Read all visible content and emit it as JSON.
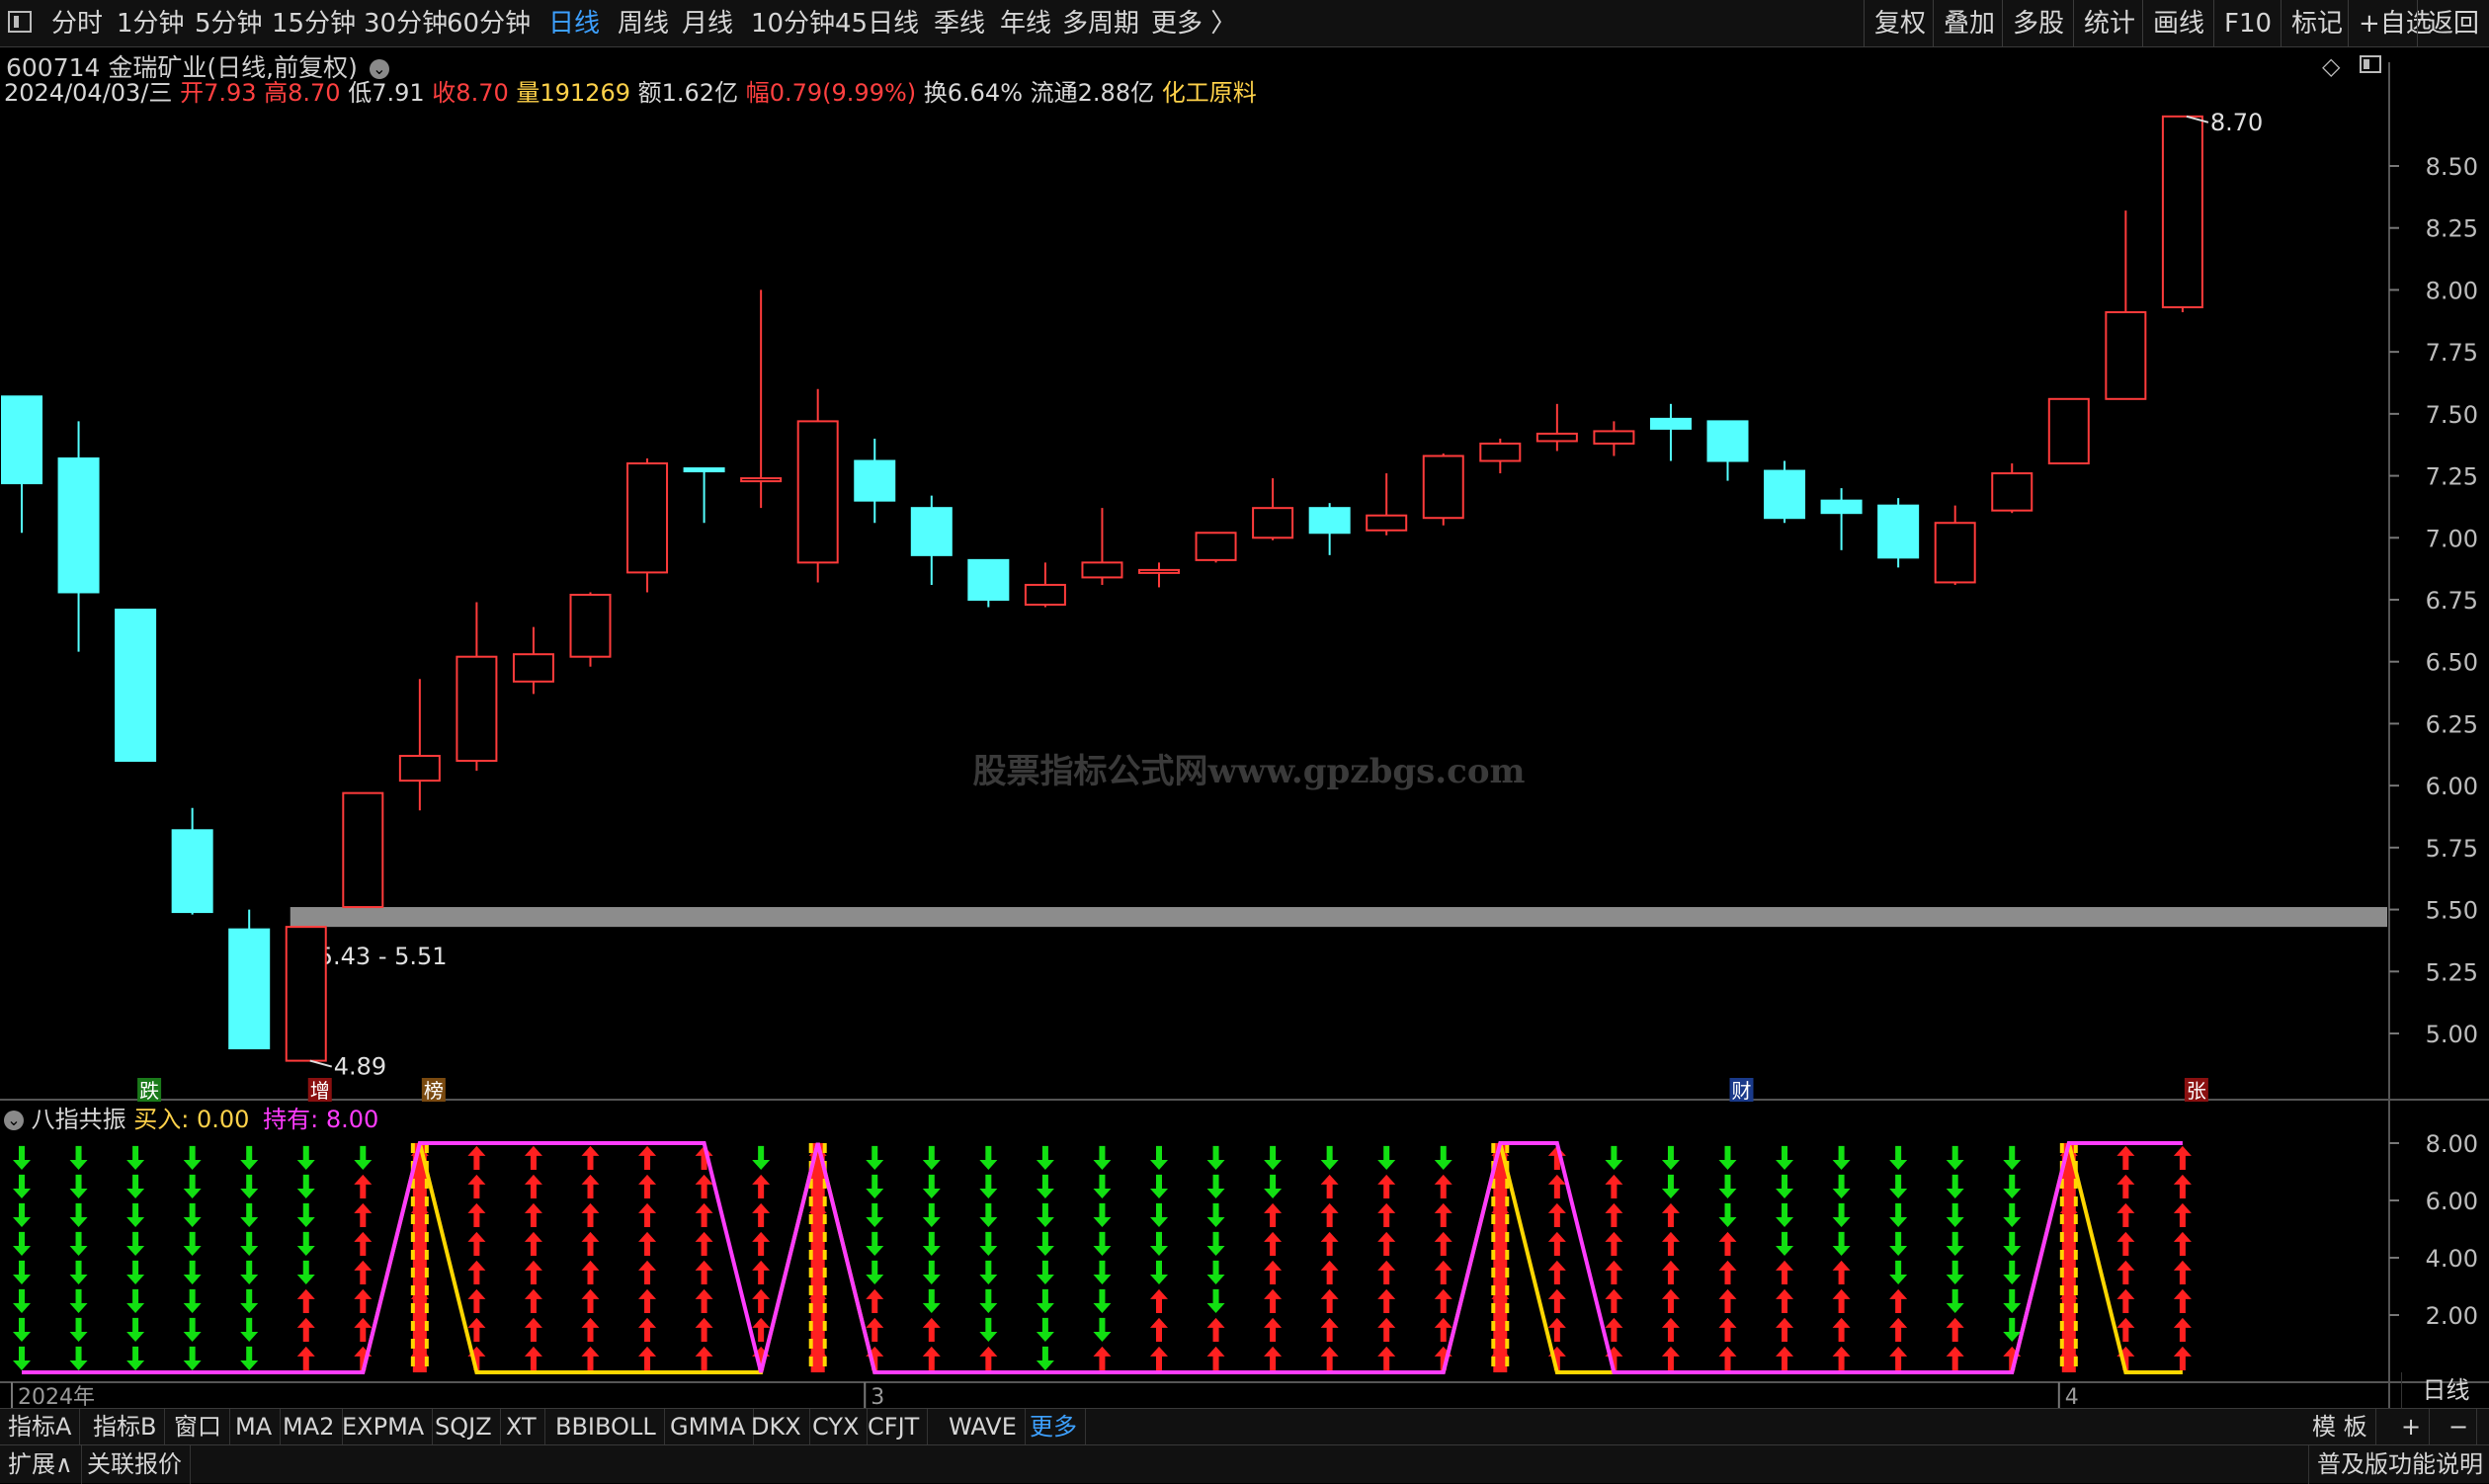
{
  "topbar": {
    "menu_icon": "panel-toggle-icon",
    "periods": [
      {
        "label": "分时",
        "active": false
      },
      {
        "label": "1分钟",
        "active": false
      },
      {
        "label": "5分钟",
        "active": false
      },
      {
        "label": "15分钟",
        "active": false
      },
      {
        "label": "30分钟",
        "active": false
      },
      {
        "label": "60分钟",
        "active": false
      },
      {
        "label": "日线",
        "active": true
      },
      {
        "label": "周线",
        "active": false
      },
      {
        "label": "月线",
        "active": false
      },
      {
        "label": "10分钟",
        "active": false
      },
      {
        "label": "45日线",
        "active": false
      },
      {
        "label": "季线",
        "active": false
      },
      {
        "label": "年线",
        "active": false
      },
      {
        "label": "多周期",
        "active": false
      },
      {
        "label": "更多 〉",
        "active": false
      }
    ],
    "right_buttons": [
      "复权",
      "叠加",
      "多股",
      "统计",
      "画线",
      "F10",
      "标记",
      "+自选",
      "返回"
    ]
  },
  "header": {
    "code_name": "600714 金瑞矿业(日线,前复权)",
    "date": "2024/04/03/三",
    "open_label": "开",
    "open": "7.93",
    "high_label": "高",
    "high": "8.70",
    "low_label": "低",
    "low": "7.91",
    "close_label": "收",
    "close": "8.70",
    "vol_label": "量",
    "vol": "191269",
    "amt_label": "额",
    "amt": "1.62亿",
    "chg_label": "幅",
    "chg": "0.79(9.99%)",
    "turn_label": "换",
    "turn": "6.64%",
    "float_label": "流通",
    "float": "2.88亿",
    "sector": "化工原料"
  },
  "watermark": "股票指标公式网www.gpzbgs.com",
  "indicator": {
    "name": "八指共振",
    "buy_label": "买入:",
    "buy_value": "0.00",
    "hold_label": "持有:",
    "hold_value": "8.00"
  },
  "chart_data": [
    {
      "type": "candlestick",
      "title": "600714 金瑞矿业(日线,前复权)",
      "ylim": [
        4.88,
        8.75
      ],
      "y_ticks": [
        "8.50",
        "8.25",
        "8.00",
        "7.75",
        "7.50",
        "7.25",
        "7.00",
        "6.75",
        "6.50",
        "6.25",
        "6.00",
        "5.75",
        "5.50",
        "5.25",
        "5.00"
      ],
      "x_ticks": [
        {
          "index": 0,
          "label": "2024年"
        },
        {
          "index": 15,
          "label": "3"
        },
        {
          "index": 36,
          "label": "4"
        }
      ],
      "candles": [
        {
          "o": 7.57,
          "h": 7.57,
          "l": 7.02,
          "c": 7.22
        },
        {
          "o": 7.32,
          "h": 7.47,
          "l": 6.54,
          "c": 6.78
        },
        {
          "o": 6.71,
          "h": 6.71,
          "l": 6.1,
          "c": 6.1
        },
        {
          "o": 5.82,
          "h": 5.91,
          "l": 5.48,
          "c": 5.49
        },
        {
          "o": 5.42,
          "h": 5.5,
          "l": 4.94,
          "c": 4.94
        },
        {
          "o": 4.89,
          "h": 5.43,
          "l": 4.89,
          "c": 5.43
        },
        {
          "o": 5.51,
          "h": 5.97,
          "l": 5.51,
          "c": 5.97
        },
        {
          "o": 6.02,
          "h": 6.43,
          "l": 5.9,
          "c": 6.12
        },
        {
          "o": 6.1,
          "h": 6.74,
          "l": 6.06,
          "c": 6.52
        },
        {
          "o": 6.42,
          "h": 6.64,
          "l": 6.37,
          "c": 6.53
        },
        {
          "o": 6.52,
          "h": 6.78,
          "l": 6.48,
          "c": 6.77
        },
        {
          "o": 6.86,
          "h": 7.32,
          "l": 6.78,
          "c": 7.3
        },
        {
          "o": 7.28,
          "h": 7.28,
          "l": 7.06,
          "c": 7.27
        },
        {
          "o": 7.24,
          "h": 8.0,
          "l": 7.12,
          "c": 7.24
        },
        {
          "o": 6.9,
          "h": 7.6,
          "l": 6.82,
          "c": 7.47
        },
        {
          "o": 7.31,
          "h": 7.4,
          "l": 7.06,
          "c": 7.15
        },
        {
          "o": 7.12,
          "h": 7.17,
          "l": 6.81,
          "c": 6.93
        },
        {
          "o": 6.91,
          "h": 6.91,
          "l": 6.72,
          "c": 6.75
        },
        {
          "o": 6.73,
          "h": 6.9,
          "l": 6.72,
          "c": 6.81
        },
        {
          "o": 6.84,
          "h": 7.12,
          "l": 6.81,
          "c": 6.9
        },
        {
          "o": 6.87,
          "h": 6.9,
          "l": 6.8,
          "c": 6.87
        },
        {
          "o": 6.91,
          "h": 7.02,
          "l": 6.9,
          "c": 7.02
        },
        {
          "o": 7.0,
          "h": 7.24,
          "l": 6.99,
          "c": 7.12
        },
        {
          "o": 7.12,
          "h": 7.14,
          "l": 6.93,
          "c": 7.02
        },
        {
          "o": 7.03,
          "h": 7.26,
          "l": 7.01,
          "c": 7.09
        },
        {
          "o": 7.08,
          "h": 7.34,
          "l": 7.05,
          "c": 7.33
        },
        {
          "o": 7.31,
          "h": 7.4,
          "l": 7.26,
          "c": 7.38
        },
        {
          "o": 7.39,
          "h": 7.54,
          "l": 7.35,
          "c": 7.42
        },
        {
          "o": 7.38,
          "h": 7.47,
          "l": 7.33,
          "c": 7.43
        },
        {
          "o": 7.48,
          "h": 7.54,
          "l": 7.31,
          "c": 7.44
        },
        {
          "o": 7.47,
          "h": 7.47,
          "l": 7.23,
          "c": 7.31
        },
        {
          "o": 7.27,
          "h": 7.31,
          "l": 7.06,
          "c": 7.08
        },
        {
          "o": 7.15,
          "h": 7.2,
          "l": 6.95,
          "c": 7.1
        },
        {
          "o": 7.13,
          "h": 7.16,
          "l": 6.88,
          "c": 6.92
        },
        {
          "o": 6.82,
          "h": 7.13,
          "l": 6.81,
          "c": 7.06
        },
        {
          "o": 7.11,
          "h": 7.3,
          "l": 7.1,
          "c": 7.26
        },
        {
          "o": 7.3,
          "h": 7.56,
          "l": 7.3,
          "c": 7.56
        },
        {
          "o": 7.56,
          "h": 8.32,
          "l": 7.56,
          "c": 7.91
        },
        {
          "o": 7.93,
          "h": 8.7,
          "l": 7.91,
          "c": 8.7
        }
      ],
      "resistance_band": {
        "low": 5.43,
        "high": 5.51,
        "from_index": 5,
        "label": "5.43 - 5.51"
      },
      "annotations": [
        {
          "index": 38,
          "value": 8.7,
          "label": "8.70"
        },
        {
          "index": 5,
          "value": 4.89,
          "label": "4.89"
        }
      ],
      "event_tags": [
        {
          "index": 2,
          "label": "跌",
          "color": "#1a7a1a"
        },
        {
          "index": 5,
          "label": "增",
          "color": "#8a1010"
        },
        {
          "index": 7,
          "label": "榜",
          "color": "#7a4a10"
        },
        {
          "index": 30,
          "label": "财",
          "color": "#1a3a8a"
        },
        {
          "index": 38,
          "label": "张",
          "color": "#8a1010"
        }
      ]
    },
    {
      "type": "line",
      "title": "八指共振",
      "ylim": [
        0,
        8
      ],
      "y_ticks": [
        "8.00",
        "6.00",
        "4.00",
        "2.00"
      ],
      "series": [
        {
          "name": "持有",
          "color": "#ff3cff",
          "values": [
            0,
            0,
            0,
            0,
            0,
            0,
            0,
            8,
            8,
            8,
            8,
            8,
            8,
            0,
            8,
            0,
            0,
            0,
            0,
            0,
            0,
            0,
            0,
            0,
            0,
            0,
            8,
            8,
            0,
            0,
            0,
            0,
            0,
            0,
            0,
            0,
            8,
            8,
            8
          ]
        },
        {
          "name": "买入",
          "color": "#ffd700",
          "values": [
            0,
            0,
            0,
            0,
            0,
            0,
            0,
            8,
            0,
            0,
            0,
            0,
            0,
            0,
            8,
            0,
            0,
            0,
            0,
            0,
            0,
            0,
            0,
            0,
            0,
            0,
            8,
            0,
            0,
            0,
            0,
            0,
            0,
            0,
            0,
            0,
            8,
            0,
            0
          ]
        }
      ],
      "arrows_up_count": [
        0,
        0,
        0,
        0,
        0,
        3,
        7,
        8,
        8,
        8,
        8,
        8,
        8,
        7,
        8,
        3,
        2,
        1,
        0,
        1,
        3,
        2,
        6,
        7,
        7,
        7,
        8,
        8,
        7,
        6,
        5,
        4,
        4,
        3,
        2,
        1,
        8,
        8,
        8
      ]
    }
  ],
  "bottom_tabs": [
    "指标A",
    "指标B",
    "窗口",
    "MA",
    "MA2",
    "EXPMA",
    "SQJZ",
    "XT",
    "BBIBOLL",
    "GMMA",
    "DKX",
    "CYX",
    "CFJT",
    "WAVE",
    "更多"
  ],
  "bottom_right": [
    "模 板",
    "+",
    "−"
  ],
  "right_axis_label": "日线",
  "bottom_row2": [
    "扩展∧",
    "关联报价"
  ],
  "bottom_row2_right": "普及版功能说明"
}
